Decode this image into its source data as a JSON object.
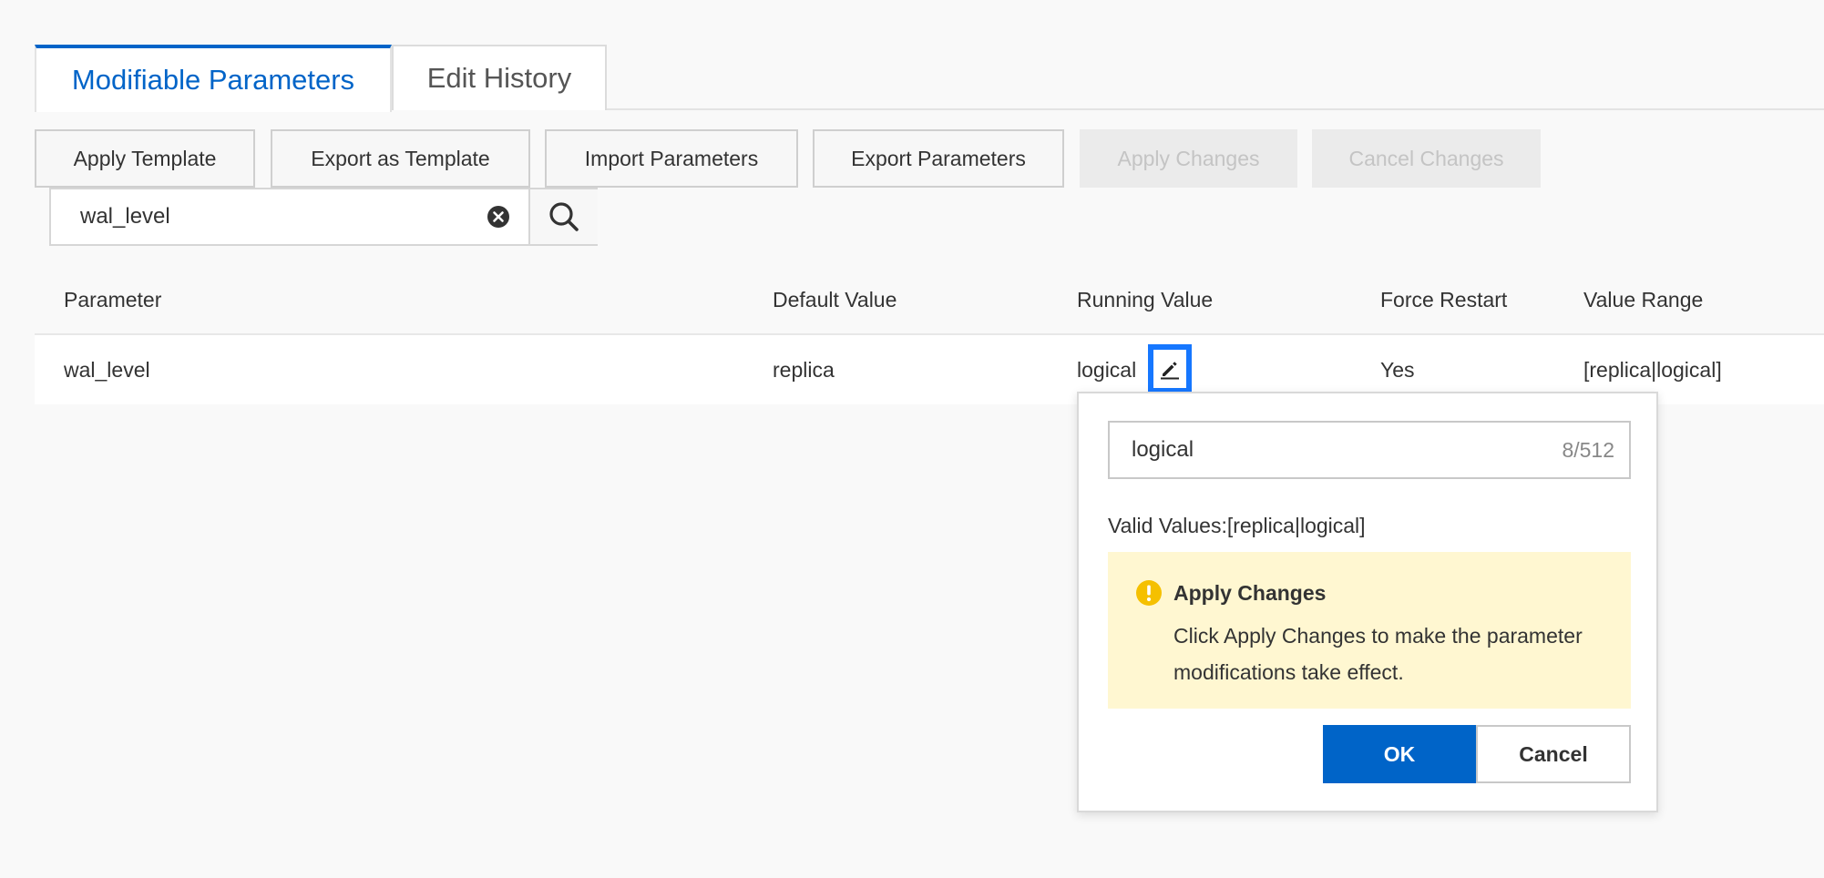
{
  "tabs": {
    "modifiable": "Modifiable Parameters",
    "history": "Edit History"
  },
  "toolbar": {
    "apply_template": "Apply Template",
    "export_template": "Export as Template",
    "import_params": "Import Parameters",
    "export_params": "Export Parameters",
    "apply_changes": "Apply Changes",
    "cancel_changes": "Cancel Changes"
  },
  "search": {
    "value": "wal_level"
  },
  "table": {
    "headers": {
      "parameter": "Parameter",
      "default": "Default Value",
      "running": "Running Value",
      "restart": "Force Restart",
      "range": "Value Range"
    },
    "rows": [
      {
        "parameter": "wal_level",
        "default": "replica",
        "running": "logical",
        "restart": "Yes",
        "range": "[replica|logical]"
      }
    ]
  },
  "popover": {
    "input_value": "logical",
    "char_count": "8/512",
    "valid_values": "Valid Values:[replica|logical]",
    "alert_title": "Apply Changes",
    "alert_body": "Click Apply Changes to make the parameter modifications take effect.",
    "ok": "OK",
    "cancel": "Cancel"
  },
  "colors": {
    "primary": "#0064c8",
    "highlight": "#1677ff",
    "warning_bg": "#fff7d1",
    "warning_icon": "#f5c000"
  }
}
